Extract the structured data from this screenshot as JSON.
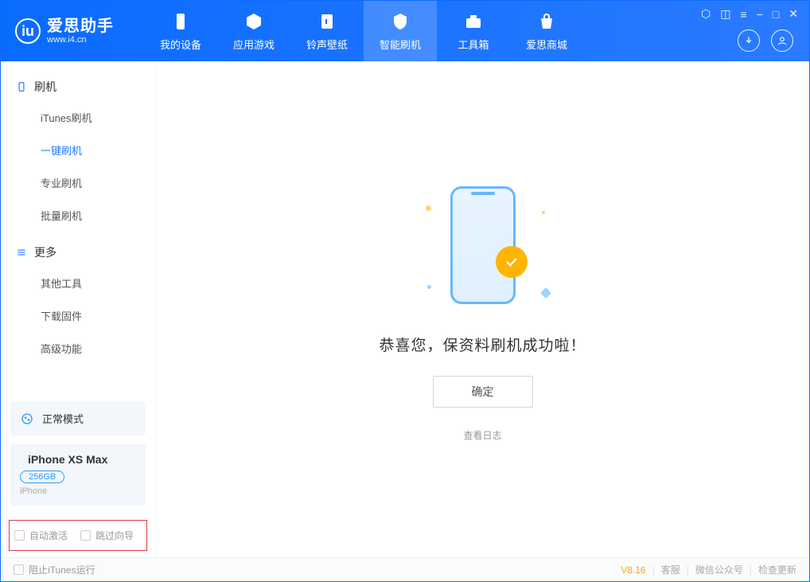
{
  "brand": {
    "name": "爱思助手",
    "url": "www.i4.cn"
  },
  "nav": [
    {
      "label": "我的设备",
      "icon": "device"
    },
    {
      "label": "应用游戏",
      "icon": "cube"
    },
    {
      "label": "铃声壁纸",
      "icon": "music"
    },
    {
      "label": "智能刷机",
      "icon": "shield",
      "active": true
    },
    {
      "label": "工具箱",
      "icon": "toolbox"
    },
    {
      "label": "爱思商城",
      "icon": "bag"
    }
  ],
  "sidebar": {
    "group1": {
      "title": "刷机",
      "items": [
        "iTunes刷机",
        "一键刷机",
        "专业刷机",
        "批量刷机"
      ],
      "active_index": 1
    },
    "group2": {
      "title": "更多",
      "items": [
        "其他工具",
        "下载固件",
        "高级功能"
      ]
    }
  },
  "mode_card": {
    "label": "正常模式"
  },
  "device": {
    "name": "iPhone XS Max",
    "storage": "256GB",
    "type": "iPhone"
  },
  "bottom_options": {
    "auto_activate": "自动激活",
    "skip_guide": "跳过向导"
  },
  "main": {
    "success": "恭喜您，保资料刷机成功啦！",
    "ok_button": "确定",
    "view_log": "查看日志"
  },
  "statusbar": {
    "stop_itunes": "阻止iTunes运行",
    "version": "V8.16",
    "links": [
      "客服",
      "微信公众号",
      "检查更新"
    ]
  }
}
